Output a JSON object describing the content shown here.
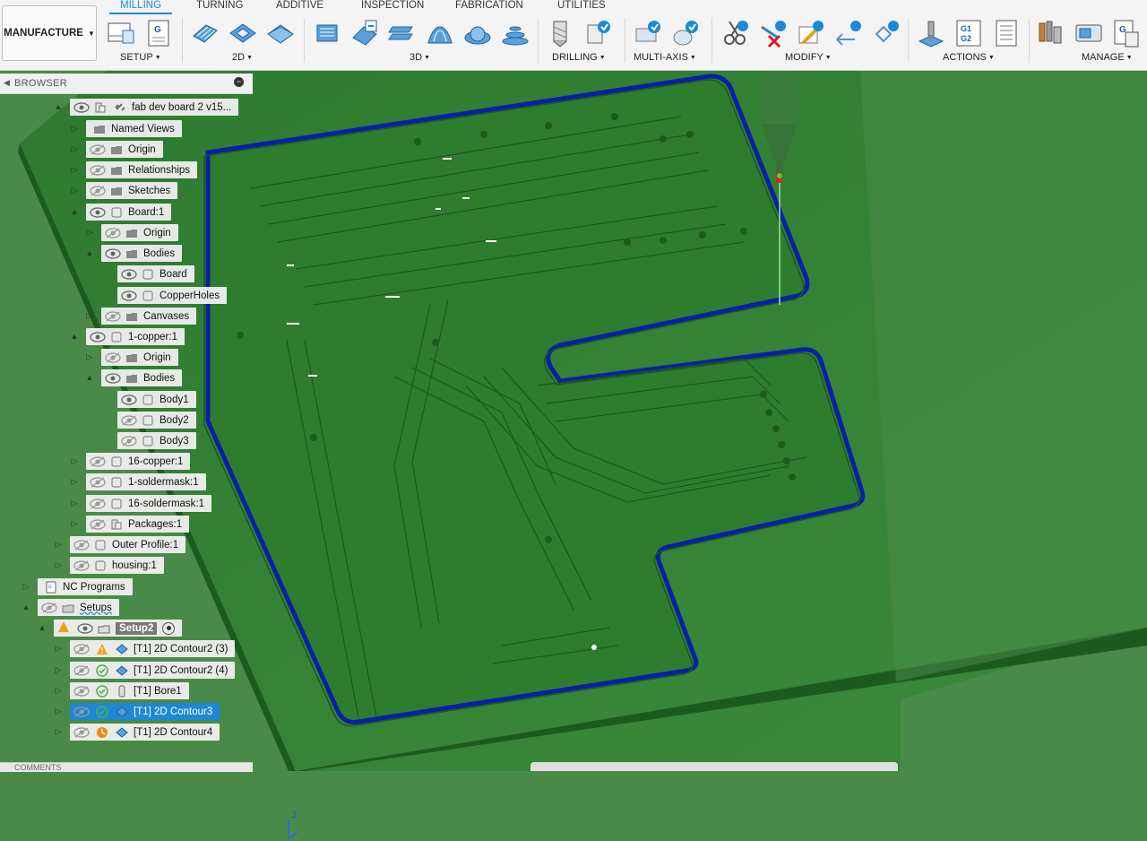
{
  "workspace": {
    "label": "MANUFACTURE"
  },
  "tabs": [
    {
      "label": "MILLING",
      "active": true
    },
    {
      "label": "TURNING"
    },
    {
      "label": "ADDITIVE"
    },
    {
      "label": "INSPECTION"
    },
    {
      "label": "FABRICATION"
    },
    {
      "label": "UTILITIES"
    }
  ],
  "groups": {
    "setup": "SETUP",
    "2d": "2D",
    "3d": "3D",
    "drilling": "DRILLING",
    "multi_axis": "MULTI-AXIS",
    "modify": "MODIFY",
    "actions": "ACTIONS",
    "manage": "MANAGE"
  },
  "browser": {
    "title": "BROWSER",
    "items": [
      {
        "label": "fab dev board 2 v15..."
      },
      {
        "label": "Named Views"
      },
      {
        "label": "Origin"
      },
      {
        "label": "Relationships"
      },
      {
        "label": "Sketches"
      },
      {
        "label": "Board:1"
      },
      {
        "label": "Origin"
      },
      {
        "label": "Bodies"
      },
      {
        "label": "Board"
      },
      {
        "label": "CopperHoles"
      },
      {
        "label": "Canvases"
      },
      {
        "label": "1-copper:1"
      },
      {
        "label": "Origin"
      },
      {
        "label": "Bodies"
      },
      {
        "label": "Body1"
      },
      {
        "label": "Body2"
      },
      {
        "label": "Body3"
      },
      {
        "label": "16-copper:1"
      },
      {
        "label": "1-soldermask:1"
      },
      {
        "label": "16-soldermask:1"
      },
      {
        "label": "Packages:1"
      },
      {
        "label": "Outer Profile:1"
      },
      {
        "label": "housing:1"
      },
      {
        "label": "NC Programs"
      },
      {
        "label": "Setups"
      },
      {
        "label": "Setup2"
      },
      {
        "label": "[T1] 2D Contour2 (3)",
        "status": "warning"
      },
      {
        "label": "[T1] 2D Contour2 (4)",
        "status": "ok"
      },
      {
        "label": "[T1] Bore1",
        "status": "ok"
      },
      {
        "label": "[T1] 2D Contour3",
        "status": "ok",
        "selected": true
      },
      {
        "label": "[T1] 2D Contour4",
        "status": "pending"
      }
    ]
  },
  "viewport": {
    "axis_labels": {
      "z": "Z",
      "x": "X"
    },
    "colors": {
      "board": "#2f7f2f",
      "side": "#1f5a20",
      "background": "#4a8a49",
      "toolpath": "#0a1fa8"
    }
  },
  "footer": {
    "comments": "COMMENTS"
  }
}
